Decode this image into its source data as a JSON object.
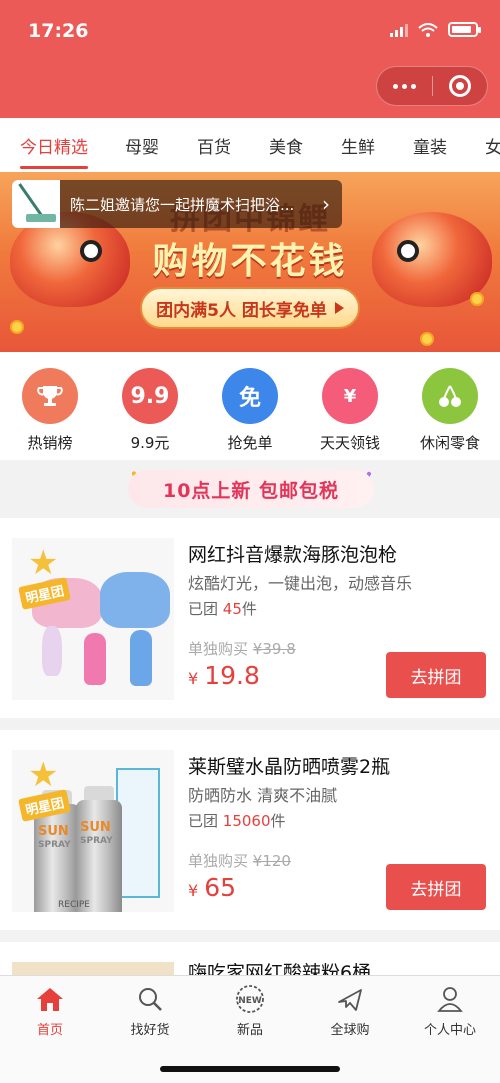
{
  "status": {
    "time": "17:26",
    "battery_level": 0.85
  },
  "colors": {
    "brand": "#ec5a57",
    "accent": "#e6403d"
  },
  "tabs": [
    {
      "label": "今日精选",
      "active": true
    },
    {
      "label": "母婴"
    },
    {
      "label": "百货"
    },
    {
      "label": "美食"
    },
    {
      "label": "生鲜"
    },
    {
      "label": "童装"
    },
    {
      "label": "女"
    }
  ],
  "banner": {
    "title_line1": "拼团中锦鲤",
    "title_line2": "购物不花钱",
    "pill_text": "团内满5人 团长享免单"
  },
  "invite": {
    "text": "陈二姐邀请您一起拼魔术扫把浴..."
  },
  "quick_links": [
    {
      "label": "热销榜",
      "icon": "trophy-icon",
      "color": "#f07a5c"
    },
    {
      "label": "9.9元",
      "glyph": "9.9",
      "icon": "price-9-9-icon",
      "color": "#ec5a57"
    },
    {
      "label": "抢免单",
      "glyph": "免",
      "icon": "free-icon",
      "color": "#3d86ea"
    },
    {
      "label": "天天领钱",
      "glyph": "¥",
      "icon": "red-envelope-icon",
      "color": "#f45c7a"
    },
    {
      "label": "休闲零食",
      "icon": "cherry-icon",
      "color": "#8cc63f"
    }
  ],
  "promo": {
    "text": "10点上新  包邮包税"
  },
  "products": [
    {
      "badge": "明星团",
      "title": "网红抖音爆款海豚泡泡枪",
      "desc": "炫酷灯光，一键出泡，动感音乐",
      "group_prefix": "已团",
      "group_count": "45",
      "group_suffix": "件",
      "single_label": "单独购买",
      "single_price": "¥39.8",
      "currency": "¥",
      "price": "19.8",
      "button": "去拼团"
    },
    {
      "badge": "明星团",
      "title": "莱斯璧水晶防晒喷雾2瓶",
      "desc": "防晒防水 清爽不油腻",
      "group_prefix": "已团",
      "group_count": "15060",
      "group_suffix": "件",
      "single_label": "单独购买",
      "single_price": "¥120",
      "currency": "¥",
      "price": "65",
      "button": "去拼团",
      "can_text": "SUN",
      "can_subtext": "SPRAY",
      "brand_text": "RECIPE"
    },
    {
      "title": "嗨吃家网红酸辣粉6桶"
    }
  ],
  "bottom_nav": [
    {
      "label": "首页",
      "icon": "home-icon",
      "active": true
    },
    {
      "label": "找好货",
      "icon": "search-icon"
    },
    {
      "label": "新品",
      "icon": "new-icon",
      "icon_text": "NEW"
    },
    {
      "label": "全球购",
      "icon": "plane-icon"
    },
    {
      "label": "个人中心",
      "icon": "user-icon"
    }
  ]
}
